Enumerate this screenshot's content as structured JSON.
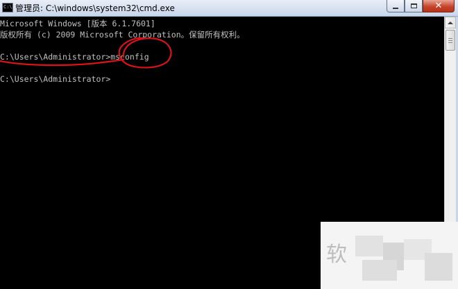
{
  "window": {
    "title": "管理员: C:\\windows\\system32\\cmd.exe",
    "icon": "cmd-icon",
    "buttons": {
      "minimize": "minimize-icon",
      "maximize": "maximize-icon",
      "close_glyph": "✕"
    }
  },
  "console": {
    "lines": [
      "Microsoft Windows [版本 6.1.7601]",
      "版权所有 (c) 2009 Microsoft Corporation。保留所有权利。",
      "C:\\Users\\Administrator>msconfig",
      "C:\\Users\\Administrator>"
    ],
    "text_color": "#c0c0c0",
    "background": "#000000"
  },
  "annotation": {
    "color": "#d8141a"
  },
  "watermark": {
    "text": "软"
  }
}
